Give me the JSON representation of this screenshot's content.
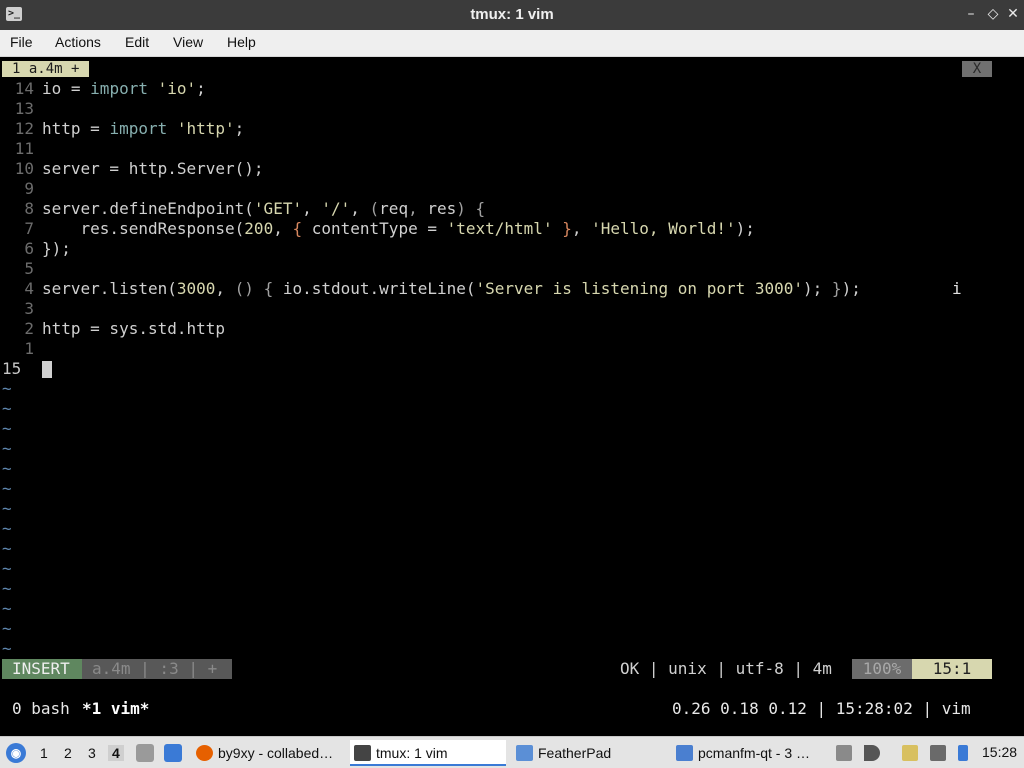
{
  "window": {
    "title": "tmux: 1 vim",
    "minimize": "–",
    "maximize": "◇",
    "close": "✕",
    "icon": "terminal-icon"
  },
  "menu": [
    "File",
    "Actions",
    "Edit",
    "View",
    "Help"
  ],
  "vim": {
    "tab_label": "1 a.4m +",
    "tab_close": "X",
    "lines": [
      {
        "nr": "14",
        "segments": [
          {
            "t": "io = "
          },
          {
            "t": "import",
            "c": "kw"
          },
          {
            "t": " "
          },
          {
            "t": "'io'",
            "c": "str"
          },
          {
            "t": ";"
          }
        ]
      },
      {
        "nr": "13",
        "segments": []
      },
      {
        "nr": "12",
        "segments": [
          {
            "t": "http = "
          },
          {
            "t": "import",
            "c": "kw"
          },
          {
            "t": " "
          },
          {
            "t": "'http'",
            "c": "str"
          },
          {
            "t": ";"
          }
        ]
      },
      {
        "nr": "11",
        "segments": []
      },
      {
        "nr": "10",
        "segments": [
          {
            "t": "server = http.Server();"
          }
        ]
      },
      {
        "nr": "9",
        "segments": []
      },
      {
        "nr": "8",
        "segments": [
          {
            "t": "server.defineEndpoint("
          },
          {
            "t": "'GET'",
            "c": "str"
          },
          {
            "t": ", "
          },
          {
            "t": "'/'",
            "c": "str"
          },
          {
            "t": ", "
          },
          {
            "t": "(",
            "c": "pn"
          },
          {
            "t": "req"
          },
          {
            "t": ", ",
            "c": "pn"
          },
          {
            "t": "res"
          },
          {
            "t": ")",
            "c": "pn"
          },
          {
            "t": " "
          },
          {
            "t": "{",
            "c": "pn"
          }
        ]
      },
      {
        "nr": "7",
        "segments": [
          {
            "t": "    res.sendResponse("
          },
          {
            "t": "200",
            "c": "str"
          },
          {
            "t": ", "
          },
          {
            "t": "{",
            "c": "br"
          },
          {
            "t": " contentType = "
          },
          {
            "t": "'text/html'",
            "c": "str"
          },
          {
            "t": " "
          },
          {
            "t": "}",
            "c": "br"
          },
          {
            "t": ", "
          },
          {
            "t": "'Hello, World!'",
            "c": "str"
          },
          {
            "t": ");"
          }
        ]
      },
      {
        "nr": "6",
        "segments": [
          {
            "t": "});"
          }
        ]
      },
      {
        "nr": "5",
        "segments": []
      },
      {
        "nr": "4",
        "segments": [
          {
            "t": "server.listen("
          },
          {
            "t": "3000",
            "c": "str"
          },
          {
            "t": ", "
          },
          {
            "t": "()",
            "c": "pn"
          },
          {
            "t": " "
          },
          {
            "t": "{",
            "c": "pn"
          },
          {
            "t": " io.stdout.writeLine("
          },
          {
            "t": "'Server is listening on port 3000'",
            "c": "str"
          },
          {
            "t": ");"
          },
          {
            "t": " "
          },
          {
            "t": "}",
            "c": "pn"
          },
          {
            "t": ");"
          }
        ]
      },
      {
        "nr": "3",
        "segments": []
      },
      {
        "nr": "2",
        "segments": [
          {
            "t": "http = sys.std.http"
          }
        ]
      },
      {
        "nr": "1",
        "segments": []
      },
      {
        "nr": "15",
        "current": true,
        "segments": []
      }
    ],
    "insert_marker": "i",
    "tilde": "~",
    "tilde_count": 14,
    "status": {
      "mode": "INSERT",
      "info": "a.4m | :3 | +",
      "right": "OK | unix | utf-8 | 4m",
      "percent": "100%",
      "position": "15:1"
    }
  },
  "tmux": {
    "win0": "0 bash",
    "win1": "*1 vim*",
    "right": "0.26 0.18 0.12 | 15:28:02 | vim"
  },
  "taskbar": {
    "workspaces": [
      "1",
      "2",
      "3",
      "4"
    ],
    "active_workspace": "4",
    "tasks": [
      {
        "label": "by9xy - collabed…",
        "icon": "firefox-icon",
        "color": "#e66000"
      },
      {
        "label": "tmux: 1 vim",
        "icon": "terminal-icon",
        "color": "#444444"
      },
      {
        "label": "FeatherPad",
        "icon": "featherpad-icon",
        "color": "#5b8fd6"
      },
      {
        "label": "pcmanfm-qt - 3 …",
        "icon": "folder-icon",
        "color": "#4a7fd0"
      }
    ],
    "clock": "15:28"
  }
}
